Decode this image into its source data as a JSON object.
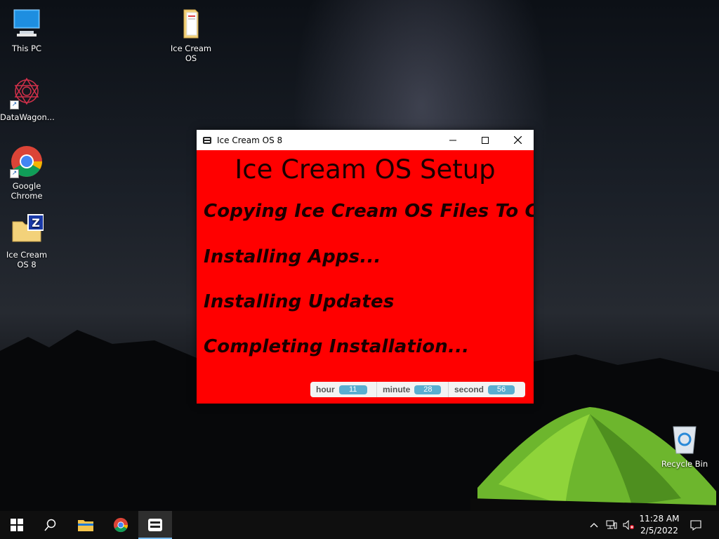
{
  "desktop": {
    "icons": [
      {
        "label": "This PC"
      },
      {
        "label": "Ice Cream OS"
      },
      {
        "label": "DataWagon..."
      },
      {
        "label": "Google Chrome"
      },
      {
        "label": "Ice Cream OS 8"
      },
      {
        "label": "Recycle Bin"
      }
    ]
  },
  "window": {
    "title": "Ice Cream OS 8",
    "heading": "Ice Cream OS Setup",
    "steps": [
      "Copying Ice Cream OS Files To C:\\...",
      "Installing Apps...",
      "Installing Updates",
      "Completing Installation..."
    ],
    "clock": {
      "hour_label": "hour",
      "hour": "11",
      "minute_label": "minute",
      "minute": "28",
      "second_label": "second",
      "second": "56"
    },
    "client_color": "#ff0000"
  },
  "taskbar": {
    "time": "11:28 AM",
    "date": "2/5/2022",
    "items": [
      "start-button",
      "search-button",
      "file-explorer",
      "google-chrome",
      "ice-cream-os-8"
    ]
  }
}
